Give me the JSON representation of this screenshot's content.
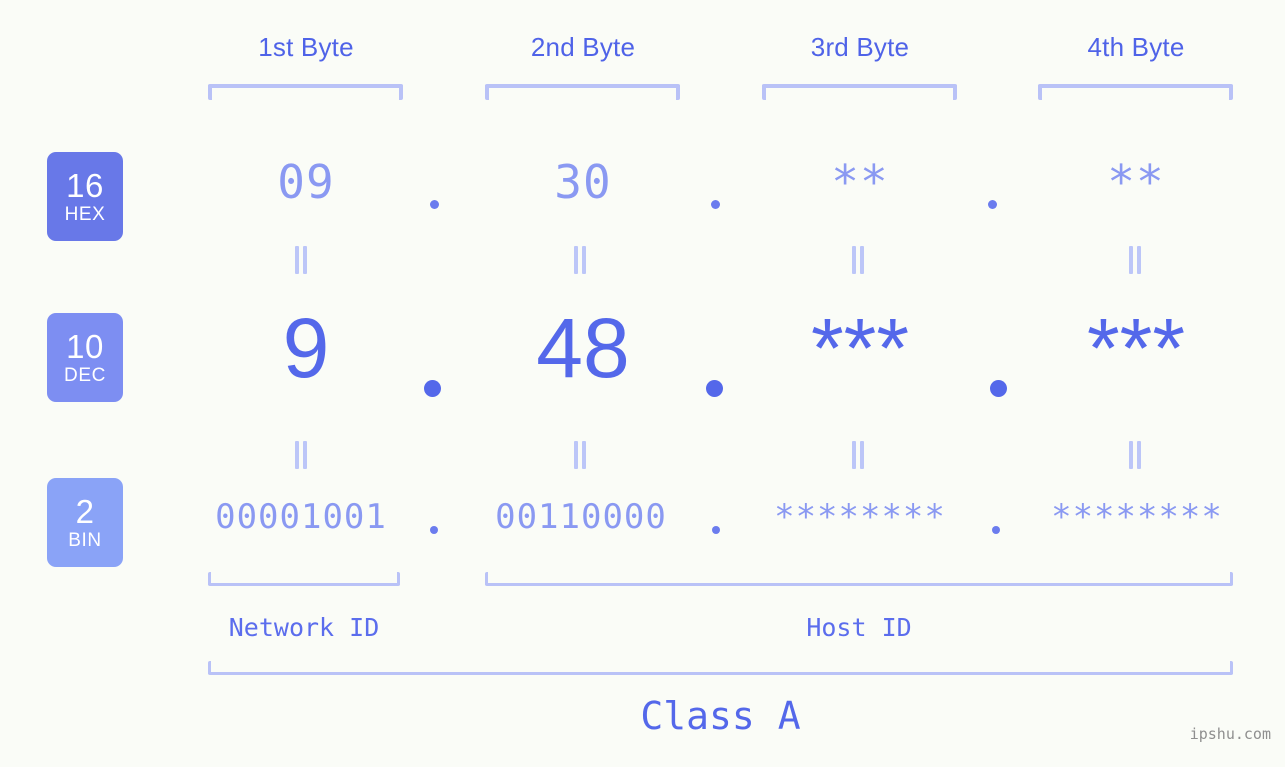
{
  "page": {
    "watermark": "ipshu.com",
    "background_color": "#fafcf7",
    "accent_color": "#5468ea",
    "muted_accent_color": "#8a99f2",
    "bracket_color": "#b9c2f7"
  },
  "byte_headers": [
    {
      "label": "1st Byte"
    },
    {
      "label": "2nd Byte"
    },
    {
      "label": "3rd Byte"
    },
    {
      "label": "4th Byte"
    }
  ],
  "rows": [
    {
      "base": "16",
      "base_abbr": "HEX",
      "badge_color": "#6878e8",
      "values": [
        "09",
        "30",
        "**",
        "**"
      ],
      "separator": "."
    },
    {
      "base": "10",
      "base_abbr": "DEC",
      "badge_color": "#7d8ef2",
      "values": [
        "9",
        "48",
        "***",
        "***"
      ],
      "separator": "."
    },
    {
      "base": "2",
      "base_abbr": "BIN",
      "badge_color": "#8aa3f7",
      "values": [
        "00001001",
        "00110000",
        "********",
        "********"
      ],
      "separator": "."
    }
  ],
  "equality_symbol": "=",
  "segments": {
    "network_id": "Network ID",
    "host_id": "Host ID"
  },
  "class_label": "Class A"
}
